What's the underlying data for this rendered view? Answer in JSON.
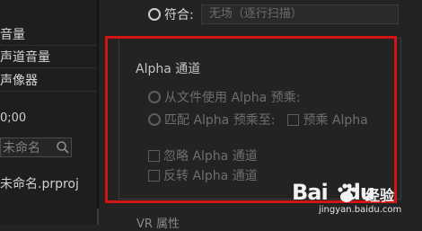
{
  "left_panel": {
    "items": [
      "音量",
      "声道音量",
      "声像器"
    ],
    "timecode": "0;00",
    "name_field_placeholder": "未命名",
    "project_file": "未命名.prproj"
  },
  "top_option": {
    "label": "符合:",
    "select_value": "无场（逐行扫描）"
  },
  "alpha_group": {
    "title": "Alpha 通道",
    "option_from_file": "从文件使用 Alpha 预乘:",
    "option_match": "匹配 Alpha 预乘至:",
    "premultiply_label": "预乘 Alpha",
    "ignore_alpha": "忽略 Alpha 通道",
    "invert_alpha": "反转 Alpha 通道"
  },
  "bottom": {
    "label": "VR 属性"
  },
  "watermark": {
    "logo": "Bai",
    "logo_tail": "du",
    "cn": "经验",
    "url": "jingyan.baidu.com"
  },
  "colors": {
    "highlight_frame": "#d11414",
    "panel_bg": "#232323"
  }
}
